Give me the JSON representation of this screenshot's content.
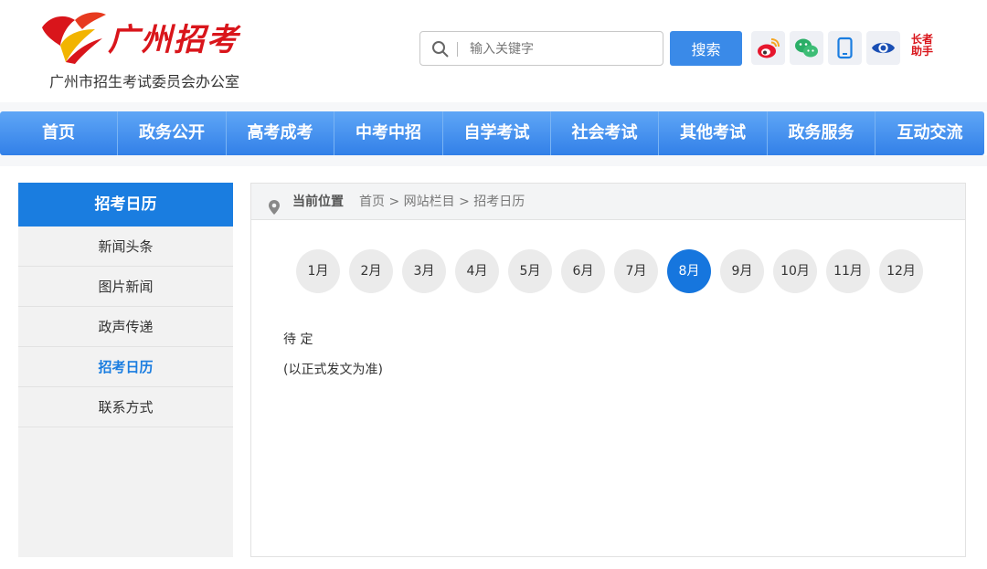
{
  "header": {
    "logo_title": "广州招考",
    "logo_subtitle": "广州市招生考试委员会办公室",
    "search_placeholder": "输入关键字",
    "search_button": "搜索",
    "elder_badge": "长者助手",
    "icons": [
      "weibo-icon",
      "wechat-icon",
      "mobile-icon",
      "eye-icon",
      "elder-assistant-icon"
    ]
  },
  "nav": {
    "items": [
      "首页",
      "政务公开",
      "高考成考",
      "中考中招",
      "自学考试",
      "社会考试",
      "其他考试",
      "政务服务",
      "互动交流"
    ]
  },
  "sidebar": {
    "title": "招考日历",
    "items": [
      {
        "label": "新闻头条",
        "active": false
      },
      {
        "label": "图片新闻",
        "active": false
      },
      {
        "label": "政声传递",
        "active": false
      },
      {
        "label": "招考日历",
        "active": true
      },
      {
        "label": "联系方式",
        "active": false
      }
    ]
  },
  "breadcrumb": {
    "label": "当前位置",
    "path": "首页 > 网站栏目 > 招考日历"
  },
  "months": {
    "items": [
      "1月",
      "2月",
      "3月",
      "4月",
      "5月",
      "6月",
      "7月",
      "8月",
      "9月",
      "10月",
      "11月",
      "12月"
    ],
    "selected": "8月"
  },
  "content": {
    "line1": "待 定",
    "line2": "(以正式发文为准)"
  },
  "colors": {
    "brand_red": "#d9151b",
    "primary_blue": "#1a7de0",
    "nav_blue": "#3a8ae8"
  }
}
